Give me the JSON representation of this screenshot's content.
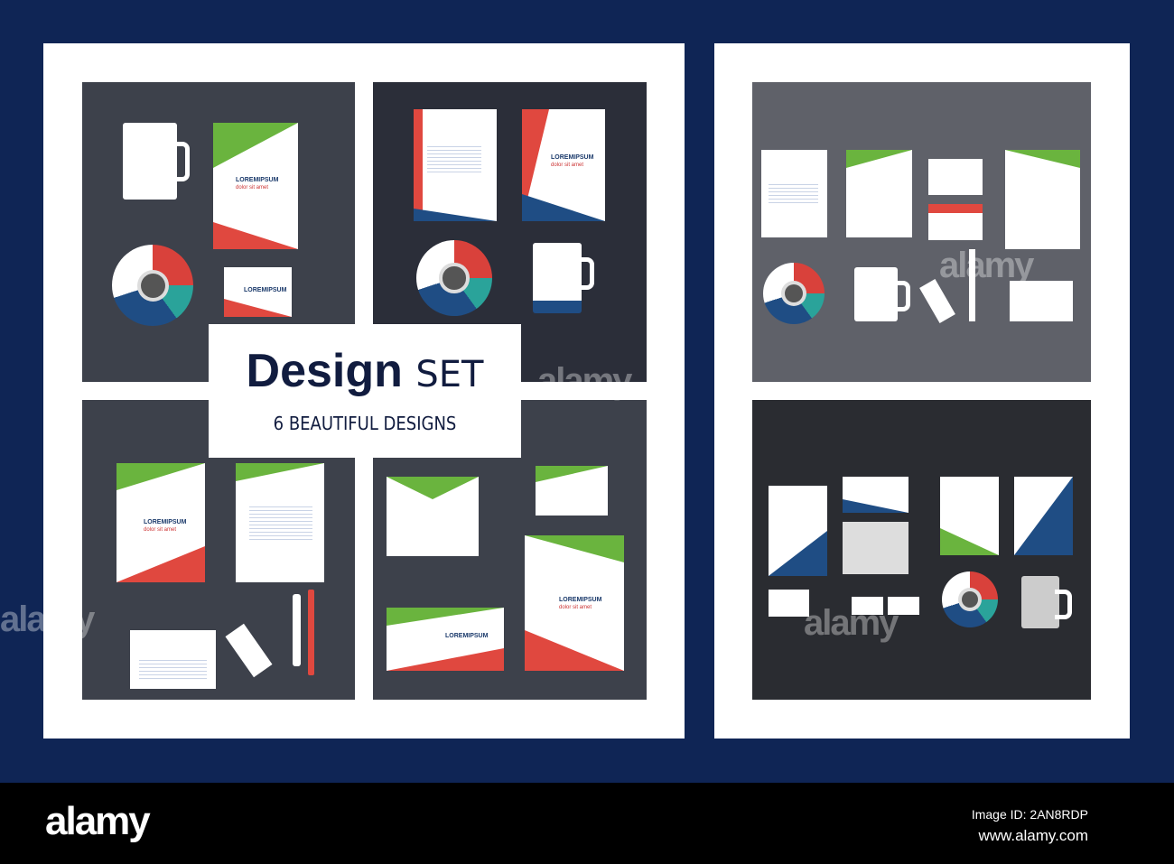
{
  "heading": {
    "title_main": "Design",
    "title_accent": "SET",
    "subtitle": "6 BEAUTIFUL DESIGNS"
  },
  "mockup_text": {
    "brand": "LOREMIPSUM",
    "tagline": "dolor sit amet"
  },
  "footer": {
    "logo": "alamy",
    "image_id": "Image ID: 2AN8RDP",
    "url": "www.alamy.com"
  },
  "watermark": "alamy",
  "colors": {
    "background": "#0f2555",
    "green": "#6ab43e",
    "red": "#e0483f",
    "navy": "#1f4d84",
    "teal": "#2aa39a"
  }
}
